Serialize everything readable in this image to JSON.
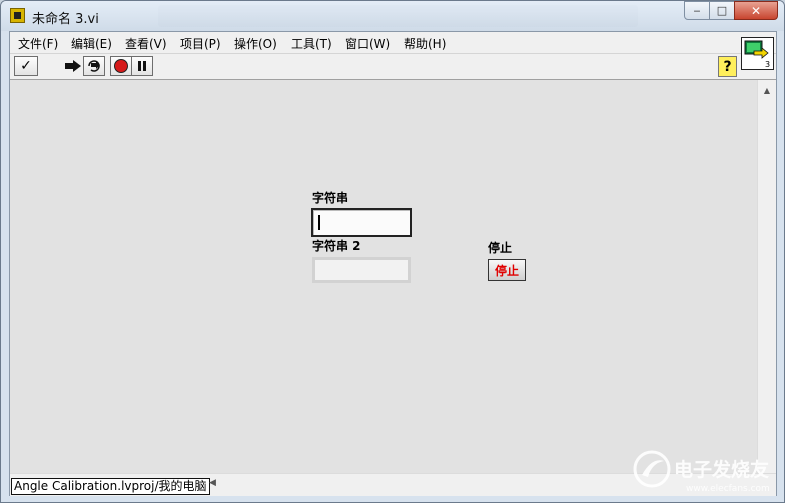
{
  "window": {
    "title": "未命名 3.vi",
    "controls": {
      "minimize": "‒",
      "maximize": "□",
      "close": "✕"
    }
  },
  "menu": [
    {
      "label": "文件(F)"
    },
    {
      "label": "编辑(E)"
    },
    {
      "label": "查看(V)"
    },
    {
      "label": "项目(P)"
    },
    {
      "label": "操作(O)"
    },
    {
      "label": "工具(T)"
    },
    {
      "label": "窗口(W)"
    },
    {
      "label": "帮助(H)"
    }
  ],
  "toolbar": {
    "buttons": [
      "run-arrow",
      "run-continuously",
      "abort-execution",
      "pause"
    ],
    "check_glyph": "✓",
    "help_glyph": "?",
    "vi_icon_number": "3"
  },
  "front_panel": {
    "string_control": {
      "label": "字符串",
      "value": ""
    },
    "string_indicator": {
      "label": "字符串 2",
      "value": ""
    },
    "stop_control": {
      "label": "停止",
      "button_text": "停止"
    }
  },
  "status_bar": {
    "project_path": "Angle Calibration.lvproj/我的电脑"
  },
  "watermark": {
    "text": "电子发烧友",
    "url": "www.elecfans.com"
  },
  "colors": {
    "panel_bg": "#e2e2e2",
    "stop_text": "#e00000",
    "title_bg": "#d7e2ee"
  }
}
